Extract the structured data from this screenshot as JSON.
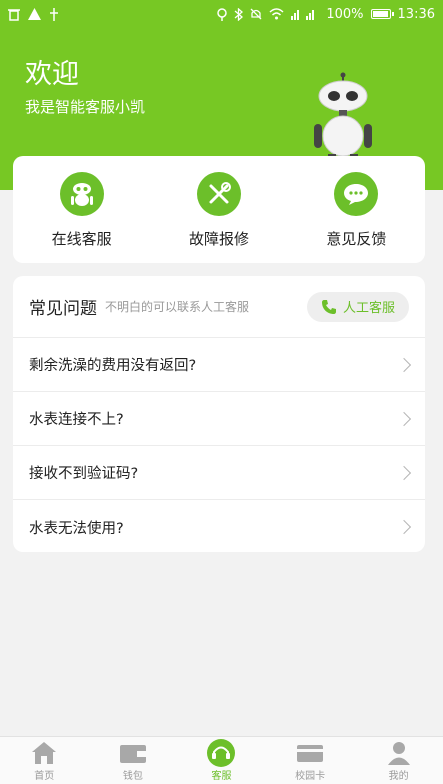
{
  "status_bar": {
    "battery": "100%",
    "time": "13:36",
    "battery_level": 1.0
  },
  "header": {
    "title": "欢迎",
    "subtitle": "我是智能客服小凯"
  },
  "services": [
    {
      "label": "在线客服",
      "icon": "robot-icon"
    },
    {
      "label": "故障报修",
      "icon": "tools-icon"
    },
    {
      "label": "意见反馈",
      "icon": "chat-bubble-icon"
    }
  ],
  "faq": {
    "title": "常见问题",
    "hint": "不明白的可以联系人工客服",
    "contact_button": "人工客服",
    "items": [
      "剩余洗澡的费用没有返回?",
      "水表连接不上?",
      "接收不到验证码?",
      "水表无法使用?"
    ]
  },
  "tabbar": {
    "tabs": [
      {
        "label": "首页",
        "icon": "home-icon"
      },
      {
        "label": "钱包",
        "icon": "wallet-icon"
      },
      {
        "label": "客服",
        "icon": "headset-icon",
        "active": true
      },
      {
        "label": "校园卡",
        "icon": "card-icon"
      },
      {
        "label": "我的",
        "icon": "user-icon"
      }
    ]
  },
  "colors": {
    "brand_green": "#77c824",
    "icon_green": "#6cbf2a"
  }
}
